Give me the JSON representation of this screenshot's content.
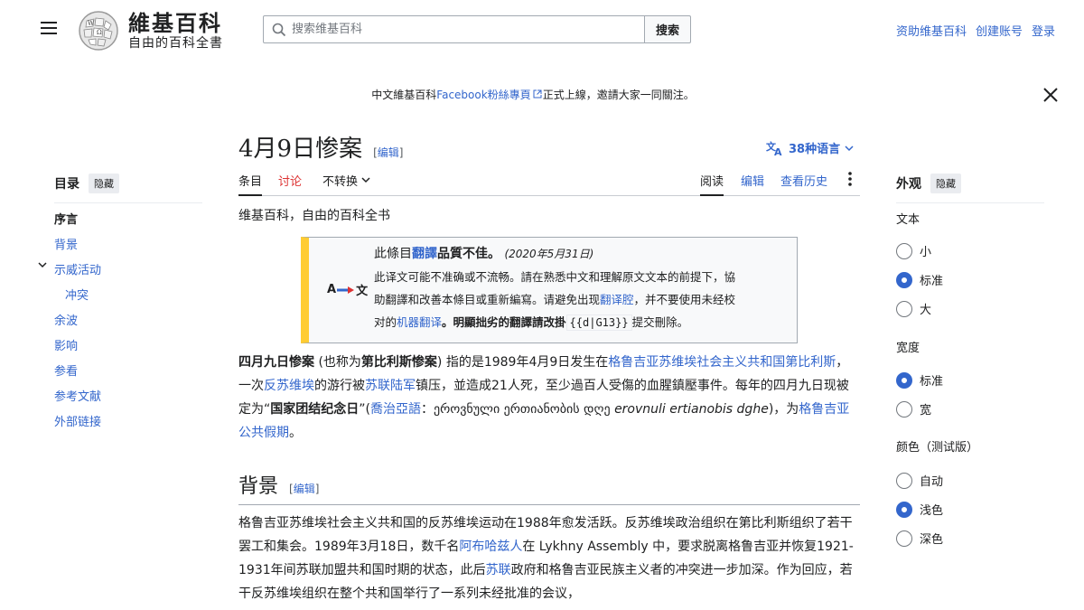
{
  "header": {
    "logo_title": "維基百科",
    "logo_tagline": "自由的百科全書",
    "search_placeholder": "搜索维基百科",
    "search_button": "搜索",
    "user_links": [
      "资助维基百科",
      "创建账号",
      "登录"
    ]
  },
  "notice": {
    "prefix": "中文維基百科",
    "link": "Facebook粉絲專頁",
    "suffix": "正式上線，邀請大家一同關注。"
  },
  "page": {
    "title": "4月9日惨案",
    "edit_label": "编辑",
    "lang_label": "38种语言",
    "tabs_left": [
      "条目",
      "讨论",
      "不转换"
    ],
    "tabs_right": [
      "阅读",
      "编辑",
      "查看历史"
    ],
    "subtitle": "维基百科，自由的百科全书"
  },
  "toc": {
    "title": "目录",
    "hide": "隐藏",
    "items": [
      "序言",
      "背景",
      "示威活动",
      "冲突",
      "余波",
      "影响",
      "参看",
      "参考文献",
      "外部链接"
    ]
  },
  "appearance": {
    "title": "外观",
    "hide": "隐藏",
    "text_label": "文本",
    "text_options": [
      "小",
      "标准",
      "大"
    ],
    "width_label": "宽度",
    "width_options": [
      "标准",
      "宽"
    ],
    "color_label": "颜色（测试版）",
    "color_options": [
      "自动",
      "浅色",
      "深色"
    ]
  },
  "ambox": {
    "icon_text": "A",
    "icon_text2": "文",
    "line1_pre": "此條目",
    "line1_link": "翻譯",
    "line1_post": "品質不佳。",
    "line1_date": "(2020年5月31日)",
    "line2": "此译文可能不准确或不流畅。請在熟悉中文和理解原文文本的前提下，協",
    "line3_pre": "助翻譯和改善本條目或重新編寫。请避免出现",
    "line3_link": "翻译腔",
    "line3_post": "，并不要使用未经校",
    "line4_pre": "对的",
    "line4_link": "机器翻译",
    "line4_post": "。明顯拙劣的翻譯請改掛",
    "line4_code": "{{d|G13}}",
    "line4_end": "提交刪除。"
  },
  "lead": {
    "b1": "四月九日惨案",
    "t1": " (也称为",
    "b2": "第比利斯惨案",
    "t2": ") 指的是1989年4月9日发生在",
    "l1": "格鲁吉亚苏维埃社会主义共和国第比利斯",
    "t3": "，一次",
    "l2": "反苏维埃",
    "t4": "的游行被",
    "l3": "苏联陆军",
    "t5": "镇压，並造成21人死，至少過百人受傷的血腥鎮壓事件。每年的四月九日现被定为“",
    "b3": "国家团结纪念日",
    "t6": "”(",
    "l4": "喬治亞語",
    "t7": "：ეროვნული ერთიანობის დღე ",
    "i1": "erovnuli ertianobis dghe",
    "t8": ")，为",
    "l5": "格鲁吉亚公共假期",
    "t9": "。"
  },
  "section_bg": {
    "title": "背景",
    "edit_label": "编辑",
    "t1": "格鲁吉亚苏维埃社会主义共和国的反苏维埃运动在1988年愈发活跃。反苏维埃政治组织在第比利斯组织了若干罢工和集会。1989年3月18日，数千名",
    "l1": "阿布哈兹人",
    "t2": "在 Lykhny Assembly 中，要求脱离格鲁吉亚并恢复1921-1931年间苏联加盟共和国时期的状态，此后",
    "l2": "苏联",
    "t3": "政府和格鲁吉亚民族主义者的冲突进一步加深。作为回应，若干反苏维埃组织在整个共和国举行了一系列未经批准的会议，"
  }
}
